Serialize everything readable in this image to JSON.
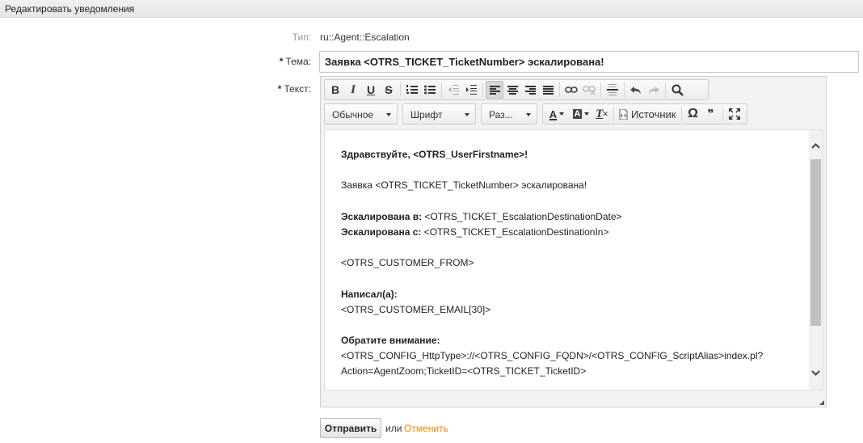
{
  "header": {
    "title": "Редактировать уведомления"
  },
  "form": {
    "type_label": "Тип:",
    "type_value": "ru::Agent::Escalation",
    "subject_star": "*",
    "subject_label": "Тема:",
    "subject_value": "Заявка <OTRS_TICKET_TicketNumber> эскалирована!",
    "text_star": "*",
    "text_label": "Текст:"
  },
  "toolbar": {
    "format_value": "Обычное",
    "font_value": "Шрифт",
    "size_value": "Раз...",
    "source_label": "Источник",
    "omega_symbol": "Ω",
    "quote_symbol": "❞",
    "bold_glyph": "B",
    "italic_glyph": "I",
    "underline_glyph": "U",
    "strike_glyph": "S",
    "text_color_glyph": "A",
    "bg_color_glyph": "A",
    "clear_format_glyph": "T"
  },
  "body": {
    "greeting": "Здравствуйте, <OTRS_UserFirstname>!",
    "line_escalated": "Заявка <OTRS_TICKET_TicketNumber> эскалирована!",
    "escalated_in_label": "Эскалирована в:",
    "escalated_in_value": " <OTRS_TICKET_EscalationDestinationDate>",
    "escalated_since_label": "Эскалирована с:",
    "escalated_since_value": " <OTRS_TICKET_EscalationDestinationIn>",
    "customer_from": "<OTRS_CUSTOMER_FROM>",
    "wrote_label": "Написал(а):",
    "customer_email": "<OTRS_CUSTOMER_EMAIL[30]>",
    "attention_label": "Обратите внимание:",
    "link_line1": "<OTRS_CONFIG_HttpType>://<OTRS_CONFIG_FQDN>/<OTRS_CONFIG_ScriptAlias>index.pl?",
    "link_line2": "Action=AgentZoom;TicketID=<OTRS_TICKET_TicketID>"
  },
  "actions": {
    "submit_label": "Отправить",
    "or_text": "или",
    "cancel_label": "Отменить"
  },
  "colors": {
    "cancel_link": "#ee8a00",
    "header_bg": "#e9e9e9"
  }
}
